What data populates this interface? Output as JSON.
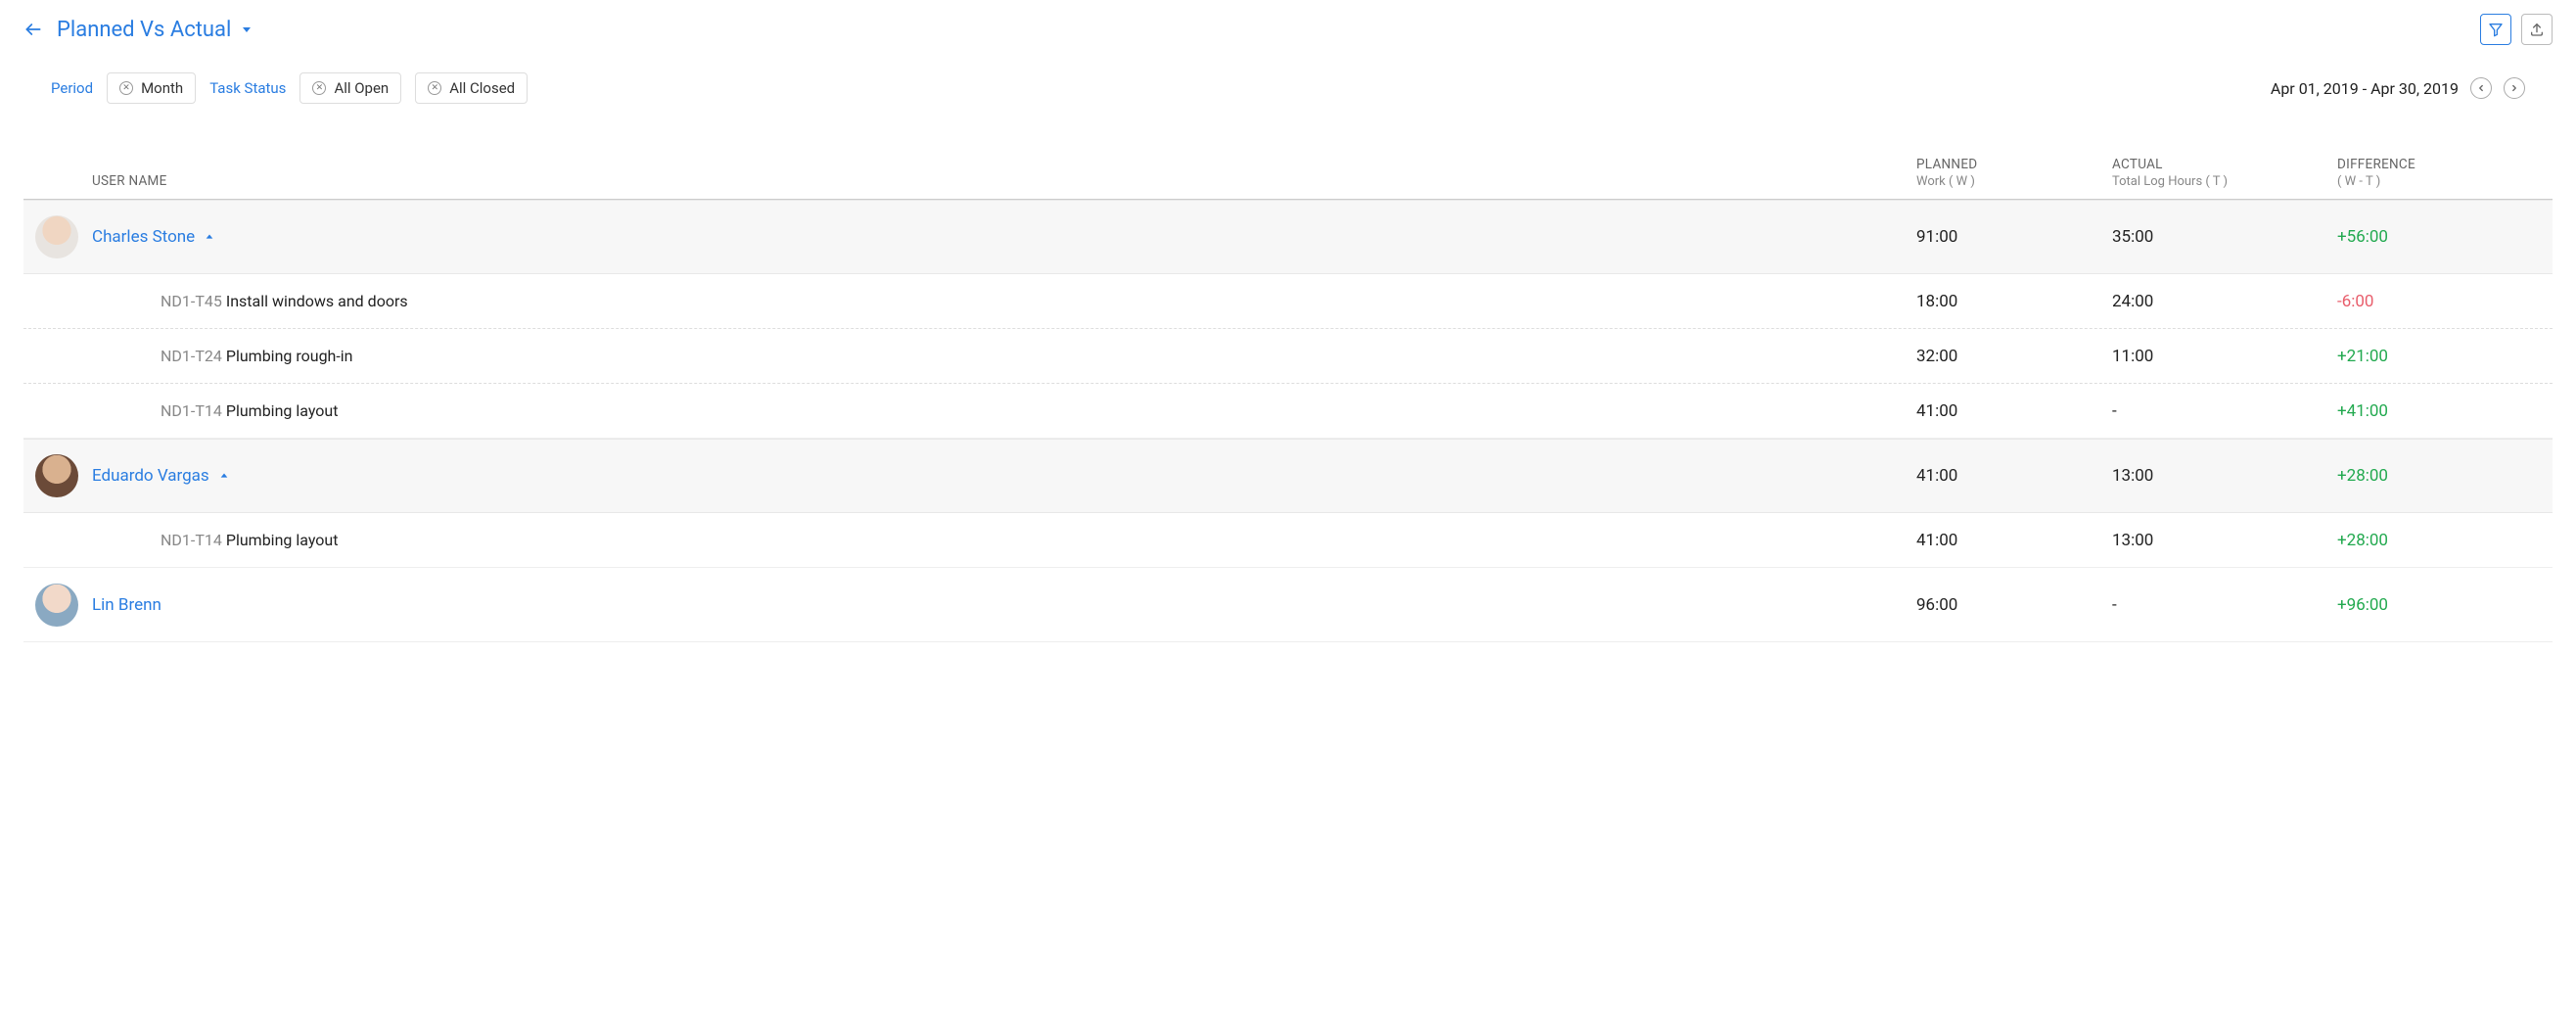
{
  "header": {
    "title": "Planned Vs Actual"
  },
  "filters": {
    "period_label": "Period",
    "period_value": "Month",
    "task_status_label": "Task Status",
    "status_open": "All Open",
    "status_closed": "All Closed",
    "date_range": "Apr 01, 2019 - Apr 30, 2019"
  },
  "columns": {
    "user": "USER NAME",
    "planned": "PLANNED",
    "planned_sub": "Work ( W )",
    "actual": "ACTUAL",
    "actual_sub": "Total Log Hours ( T )",
    "difference": "DIFFERENCE",
    "difference_sub": "( W - T )"
  },
  "users": [
    {
      "name": "Charles Stone",
      "expanded": true,
      "avatar": "av1",
      "planned": "91:00",
      "actual": "35:00",
      "difference": "+56:00",
      "diff_sign": "pos",
      "tasks": [
        {
          "id": "ND1-T45",
          "title": "Install windows and doors",
          "planned": "18:00",
          "actual": "24:00",
          "difference": "-6:00",
          "diff_sign": "neg"
        },
        {
          "id": "ND1-T24",
          "title": "Plumbing rough-in",
          "planned": "32:00",
          "actual": "11:00",
          "difference": "+21:00",
          "diff_sign": "pos"
        },
        {
          "id": "ND1-T14",
          "title": "Plumbing layout",
          "planned": "41:00",
          "actual": "-",
          "difference": "+41:00",
          "diff_sign": "pos"
        }
      ]
    },
    {
      "name": "Eduardo Vargas",
      "expanded": true,
      "avatar": "av2",
      "planned": "41:00",
      "actual": "13:00",
      "difference": "+28:00",
      "diff_sign": "pos",
      "tasks": [
        {
          "id": "ND1-T14",
          "title": "Plumbing layout",
          "planned": "41:00",
          "actual": "13:00",
          "difference": "+28:00",
          "diff_sign": "pos"
        }
      ]
    },
    {
      "name": "Lin Brenn",
      "expanded": false,
      "avatar": "av3",
      "planned": "96:00",
      "actual": "-",
      "difference": "+96:00",
      "diff_sign": "pos",
      "tasks": []
    }
  ]
}
